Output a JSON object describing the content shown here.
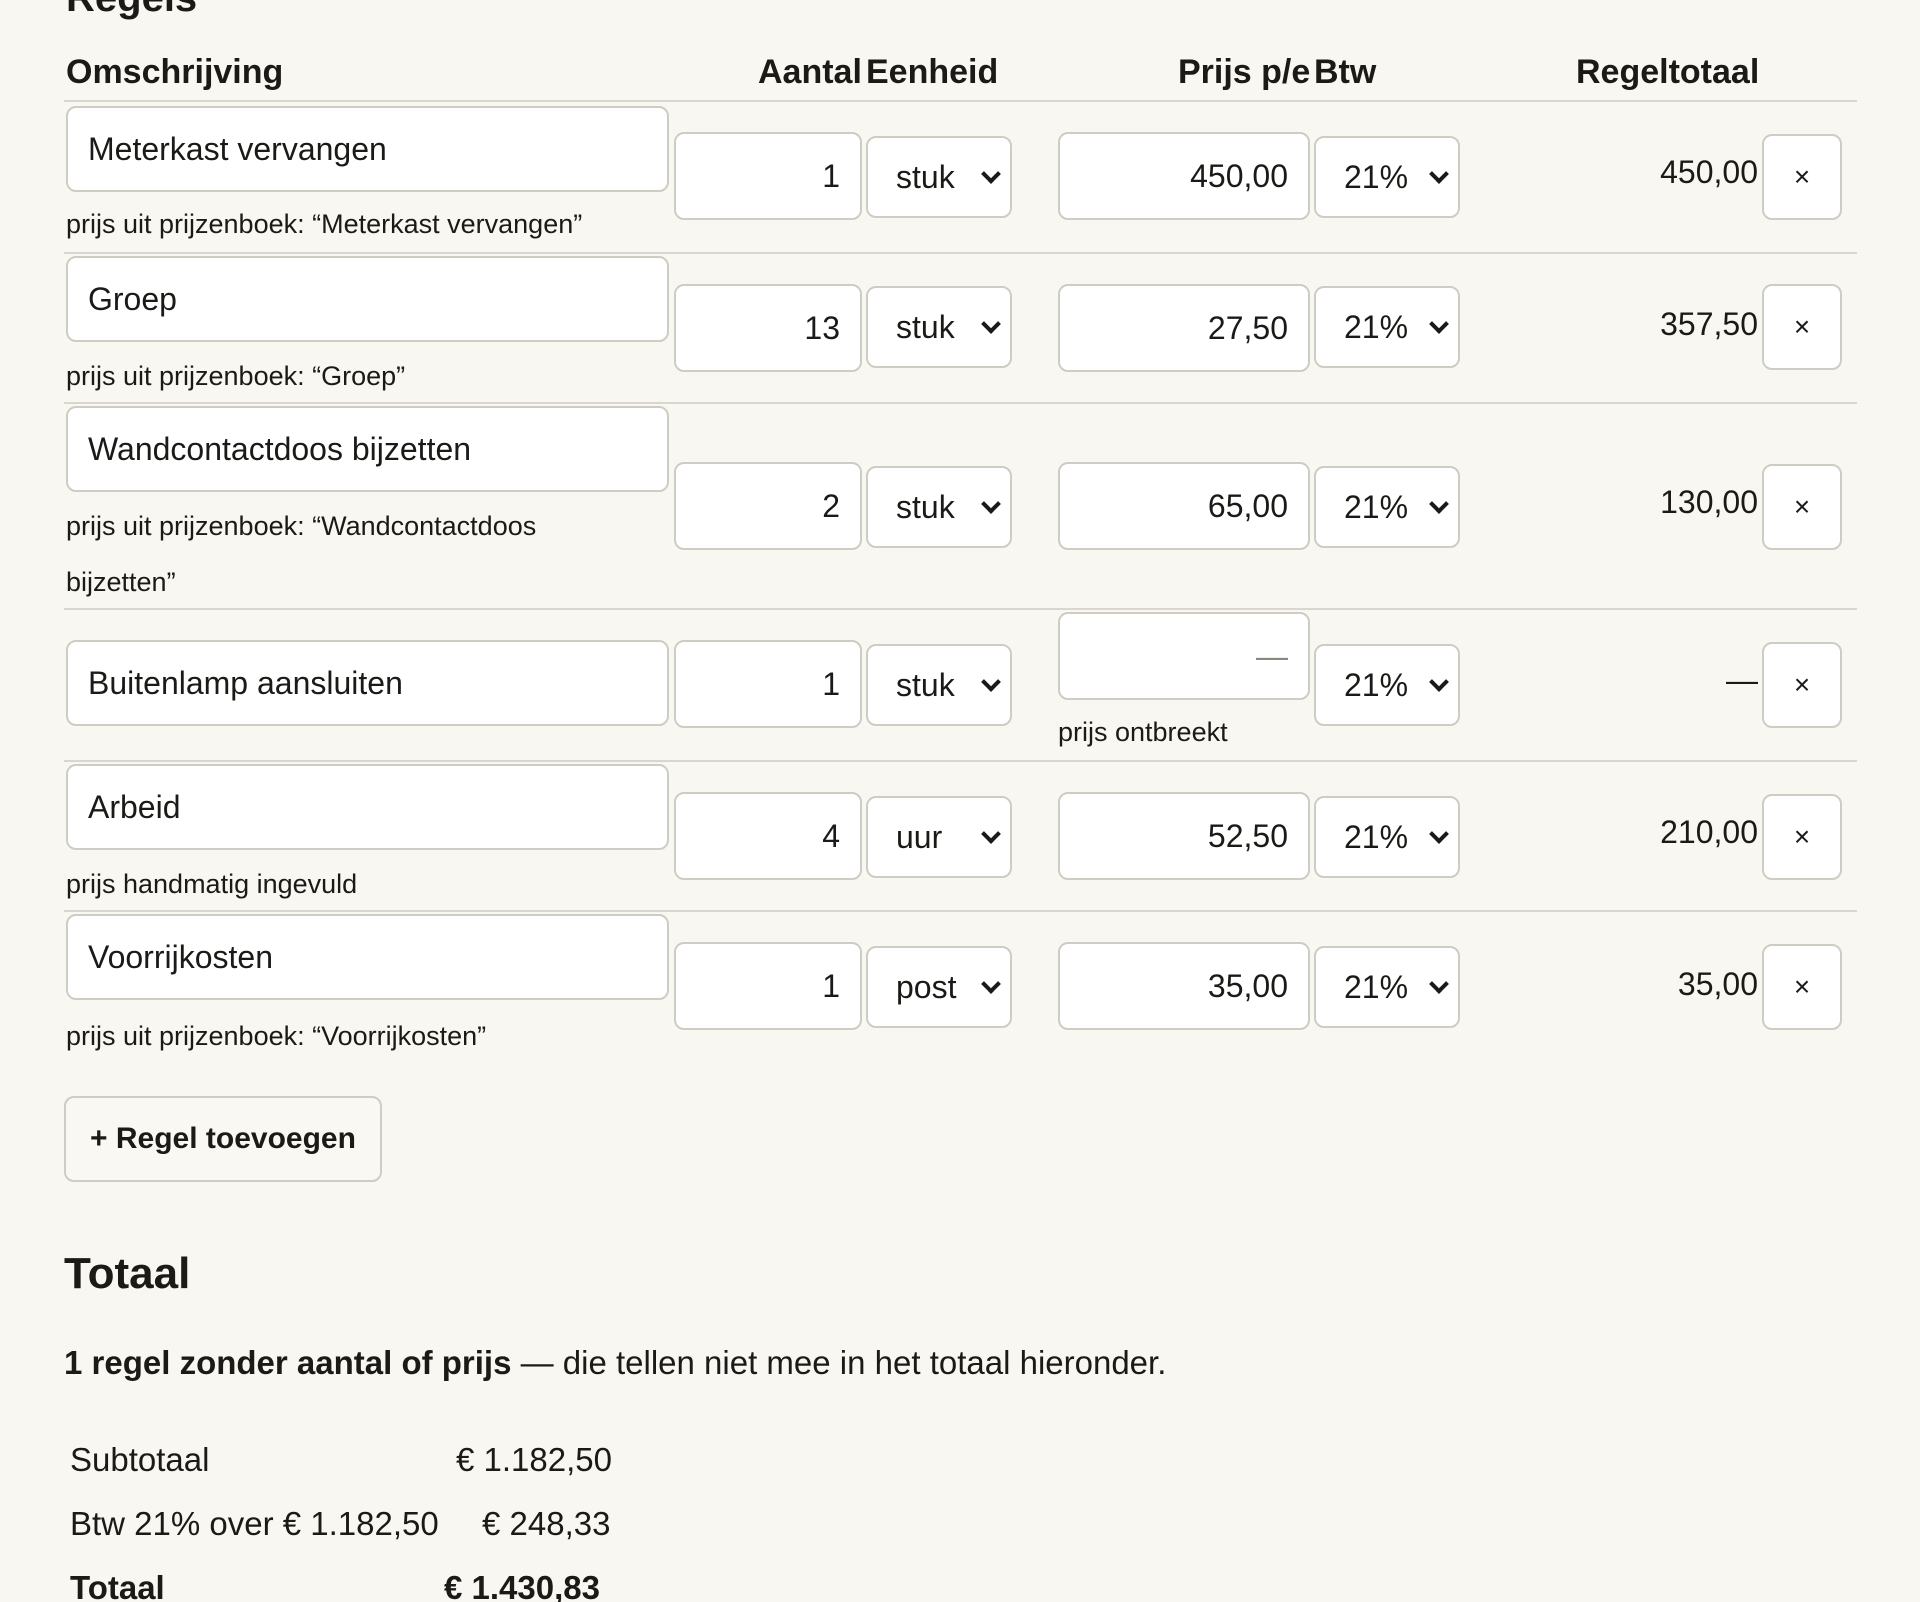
{
  "section_title": "Regels",
  "columns": {
    "description": "Omschrijving",
    "quantity": "Aantal",
    "unit": "Eenheid",
    "price": "Prijs p/e",
    "vat": "Btw",
    "line_total": "Regeltotaal"
  },
  "lines": [
    {
      "description": "Meterkast vervangen",
      "quantity": "1",
      "unit": "stuk",
      "price": "450,00",
      "vat": "21%",
      "total": "450,00",
      "note": "prijs uit prijzenboek: “Meterkast vervangen”",
      "remove": "×"
    },
    {
      "description": "Groep",
      "quantity": "13",
      "unit": "stuk",
      "price": "27,50",
      "vat": "21%",
      "total": "357,50",
      "note": "prijs uit prijzenboek: “Groep”",
      "remove": "×"
    },
    {
      "description": "Wandcontactdoos bijzetten",
      "quantity": "2",
      "unit": "stuk",
      "price": "65,00",
      "vat": "21%",
      "total": "130,00",
      "note": "prijs uit prijzenboek: “Wandcontactdoos bijzetten”",
      "remove": "×"
    },
    {
      "description": "Buitenlamp aansluiten",
      "quantity": "1",
      "unit": "stuk",
      "price": "",
      "price_placeholder": "—",
      "vat": "21%",
      "total": "—",
      "note": "prijs ontbreekt",
      "remove": "×"
    },
    {
      "description": "Arbeid",
      "quantity": "4",
      "unit": "uur",
      "price": "52,50",
      "vat": "21%",
      "total": "210,00",
      "note": "prijs handmatig ingevuld",
      "remove": "×"
    },
    {
      "description": "Voorrijkosten",
      "quantity": "1",
      "unit": "post",
      "price": "35,00",
      "vat": "21%",
      "total": "35,00",
      "note": "prijs uit prijzenboek: “Voorrijkosten”",
      "remove": "×"
    }
  ],
  "add_line_label": "+ Regel toevoegen",
  "totals": {
    "heading": "Totaal",
    "warning_bold": "1 regel zonder aantal of prijs",
    "warning_rest": " — die tellen niet mee in het totaal hieronder.",
    "subtotal_label": "Subtotaal",
    "subtotal_value": "€ 1.182,50",
    "vat_label": "Btw 21% over € 1.182,50",
    "vat_value": "€ 248,33",
    "total_label": "Totaal",
    "total_value": "€ 1.430,83"
  }
}
